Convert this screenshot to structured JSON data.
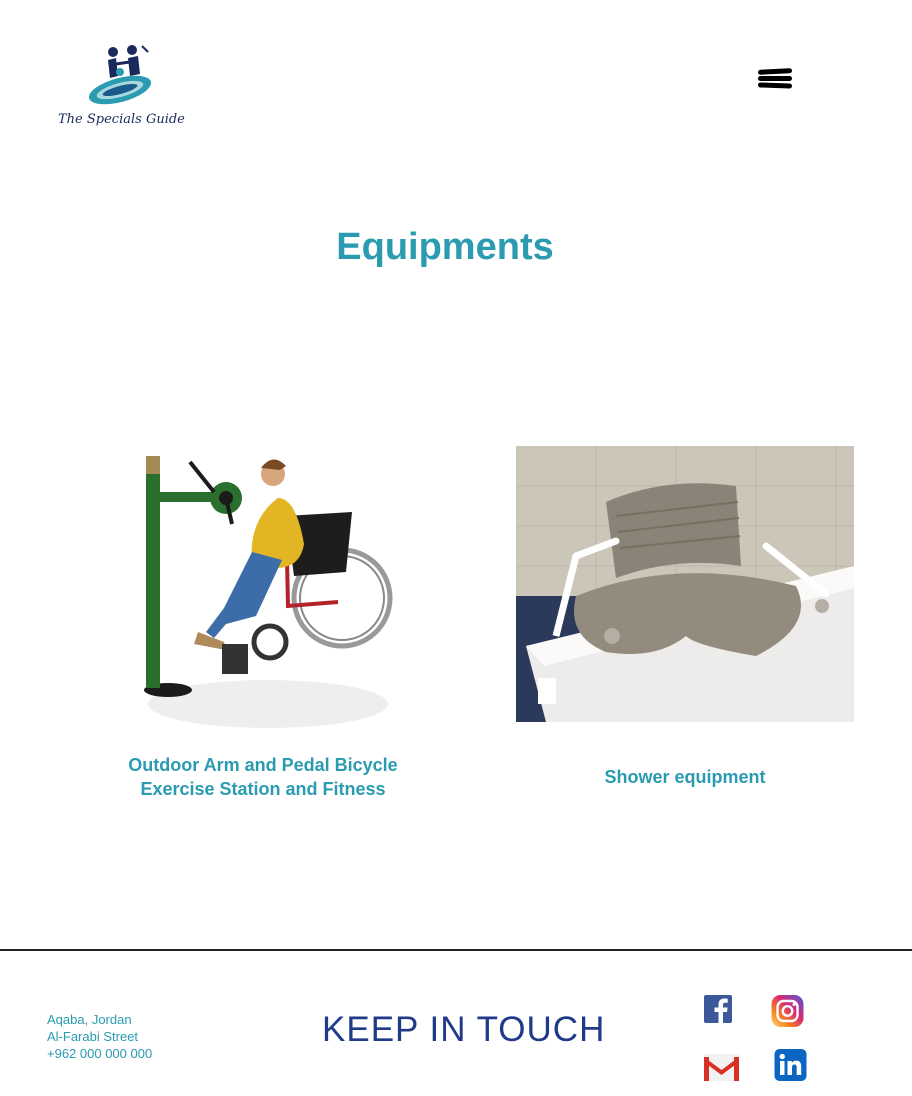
{
  "header": {
    "logo_text": "The Specials Guide",
    "menu_icon": "hamburger-menu-icon"
  },
  "main": {
    "title": "Equipments",
    "cards": [
      {
        "caption_line1": "Outdoor Arm and Pedal Bicycle",
        "caption_line2": "Exercise Station and Fitness"
      },
      {
        "caption": "Shower equipment"
      }
    ]
  },
  "footer": {
    "address_line1": "Aqaba, Jordan",
    "address_line2": "Al-Farabi Street",
    "phone": "+962 000 000 000",
    "keep_in_touch": "KEEP IN TOUCH",
    "social_icons": [
      "facebook-icon",
      "instagram-icon",
      "gmail-icon",
      "linkedin-icon"
    ]
  },
  "colors": {
    "accent": "#2a9bb0",
    "heading_blue": "#1f3a8a",
    "logo_navy": "#1a2a5c"
  }
}
